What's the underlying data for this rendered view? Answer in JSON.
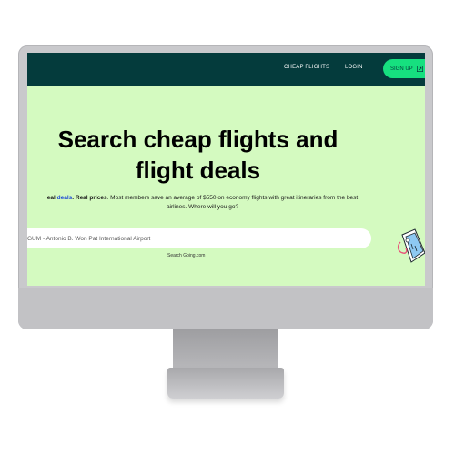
{
  "header": {
    "nav_cheap_flights": "CHEAP FLIGHTS",
    "nav_login": "LOGIN",
    "signup_label": "SIGN UP",
    "signup_icon": "arrow-up-right-icon"
  },
  "hero": {
    "title_line1": "Search cheap flights and",
    "title_line2": "flight deals",
    "subtitle_prefix": "eal",
    "subtitle_deals": "deals",
    "subtitle_real_prices": "Real prices",
    "subtitle_rest_line1": ". Most members save an average of $550 on economy flights with great itineraries from the best",
    "subtitle_line2": "airlines. Where will you go?",
    "search_value": "GUM - Antonio B. Won Pat International Airport",
    "search_credit": "Search Going.com"
  },
  "colors": {
    "header_bg": "#043b3c",
    "screen_bg": "#d4fac0",
    "signup_bg": "#16e07f",
    "deals_link": "#1b47d6"
  }
}
